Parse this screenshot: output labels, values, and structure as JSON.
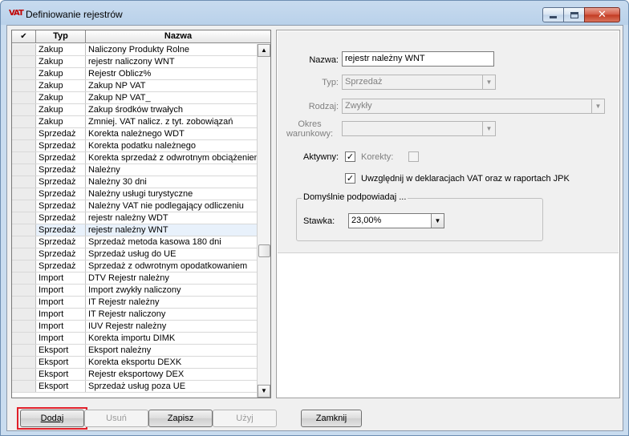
{
  "window": {
    "title": "Definiowanie rejestrów",
    "app_icon": "VAT"
  },
  "grid": {
    "headers": {
      "check": "✔",
      "typ": "Typ",
      "nazwa": "Nazwa"
    },
    "rows": [
      {
        "typ": "Zakup",
        "nazwa": "Naliczony Produkty Rolne"
      },
      {
        "typ": "Zakup",
        "nazwa": "rejestr naliczony WNT"
      },
      {
        "typ": "Zakup",
        "nazwa": "Rejestr Oblicz%"
      },
      {
        "typ": "Zakup",
        "nazwa": "Zakup NP VAT"
      },
      {
        "typ": "Zakup",
        "nazwa": "Zakup NP VAT_"
      },
      {
        "typ": "Zakup",
        "nazwa": "Zakup środków trwałych"
      },
      {
        "typ": "Zakup",
        "nazwa": "Zmniej. VAT nalicz. z tyt. zobowiązań"
      },
      {
        "typ": "Sprzedaż",
        "nazwa": "Korekta należnego WDT"
      },
      {
        "typ": "Sprzedaż",
        "nazwa": "Korekta podatku należnego"
      },
      {
        "typ": "Sprzedaż",
        "nazwa": "Korekta sprzedaż z odwrotnym obciążeniem"
      },
      {
        "typ": "Sprzedaż",
        "nazwa": "Należny"
      },
      {
        "typ": "Sprzedaż",
        "nazwa": "Należny 30 dni"
      },
      {
        "typ": "Sprzedaż",
        "nazwa": "Należny usługi turystyczne"
      },
      {
        "typ": "Sprzedaż",
        "nazwa": "Należny VAT nie podlegający odliczeniu"
      },
      {
        "typ": "Sprzedaż",
        "nazwa": "rejestr należny WDT"
      },
      {
        "typ": "Sprzedaż",
        "nazwa": "rejestr należny WNT"
      },
      {
        "typ": "Sprzedaż",
        "nazwa": "Sprzedaż metoda kasowa 180 dni"
      },
      {
        "typ": "Sprzedaż",
        "nazwa": "Sprzedaż usług do UE"
      },
      {
        "typ": "Sprzedaż",
        "nazwa": "Sprzedaż z odwrotnym opodatkowaniem"
      },
      {
        "typ": "Import",
        "nazwa": "DTV Rejestr należny"
      },
      {
        "typ": "Import",
        "nazwa": "Import zwykły naliczony"
      },
      {
        "typ": "Import",
        "nazwa": "IT Rejestr należny"
      },
      {
        "typ": "Import",
        "nazwa": "IT Rejestr naliczony"
      },
      {
        "typ": "Import",
        "nazwa": "IUV Rejestr należny"
      },
      {
        "typ": "Import",
        "nazwa": "Korekta importu DIMK"
      },
      {
        "typ": "Eksport",
        "nazwa": "Eksport należny"
      },
      {
        "typ": "Eksport",
        "nazwa": "Korekta eksportu DEXK"
      },
      {
        "typ": "Eksport",
        "nazwa": "Rejestr eksportowy DEX"
      },
      {
        "typ": "Eksport",
        "nazwa": "Sprzedaż usług poza UE"
      }
    ],
    "selected_index": 15
  },
  "form": {
    "nazwa_label": "Nazwa:",
    "nazwa_value": "rejestr należny WNT",
    "typ_label": "Typ:",
    "typ_value": "Sprzedaż",
    "rodzaj_label": "Rodzaj:",
    "rodzaj_value": "Zwykły",
    "okres_label_1": "Okres",
    "okres_label_2": "warunkowy:",
    "okres_value": "",
    "aktywny_label": "Aktywny:",
    "aktywny_checked": true,
    "korekty_label": "Korekty:",
    "korekty_checked": false,
    "deklaracje_label": "Uwzględnij w deklaracjach VAT oraz w raportach JPK",
    "deklaracje_checked": true,
    "group_title": "Domyślnie podpowiadaj ...",
    "stawka_label": "Stawka:",
    "stawka_value": "23,00%"
  },
  "buttons": {
    "dodaj": "Dodaj",
    "usun": "Usuń",
    "zapisz": "Zapisz",
    "uzyj": "Użyj",
    "zamknij": "Zamknij"
  },
  "colors": {
    "highlight": "#e0202a",
    "close_button": "#c23a22"
  }
}
